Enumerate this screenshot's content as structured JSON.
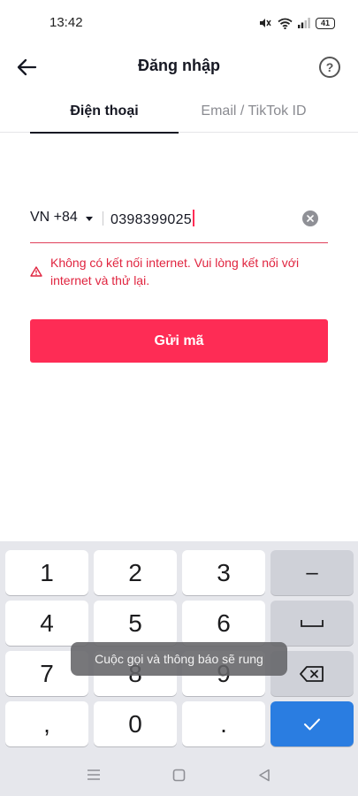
{
  "status_bar": {
    "time": "13:42",
    "battery": "41",
    "icons": [
      "mute-vibrate-icon",
      "wifi-icon",
      "signal-icon",
      "battery-icon"
    ]
  },
  "header": {
    "title": "Đăng nhập",
    "back_icon": "arrow-left-icon",
    "help_icon": "question-circle-icon",
    "help_glyph": "?"
  },
  "tabs": [
    {
      "label": "Điện thoại",
      "active": true
    },
    {
      "label": "Email / TikTok ID",
      "active": false
    }
  ],
  "phone": {
    "country_code": "VN +84",
    "value": "0398399025"
  },
  "error": {
    "message": "Không có kết nối internet. Vui lòng kết nối với internet và thử lại.",
    "color": "#e0243f"
  },
  "send_button": {
    "label": "Gửi mã",
    "color": "#fe2c55"
  },
  "keyboard": {
    "keys": [
      "1",
      "2",
      "3",
      "–",
      "4",
      "5",
      "6",
      "7",
      "8",
      "9",
      ",",
      "0",
      "."
    ],
    "space_icon": "space-icon",
    "backspace_icon": "backspace-icon",
    "enter_icon": "checkmark-icon",
    "enter_color": "#2a7de1"
  },
  "toast": {
    "message": "Cuộc gọi và thông báo sẽ rung"
  },
  "nav_bar": {
    "icons": [
      "menu-icon",
      "home-icon",
      "back-triangle-icon"
    ]
  }
}
